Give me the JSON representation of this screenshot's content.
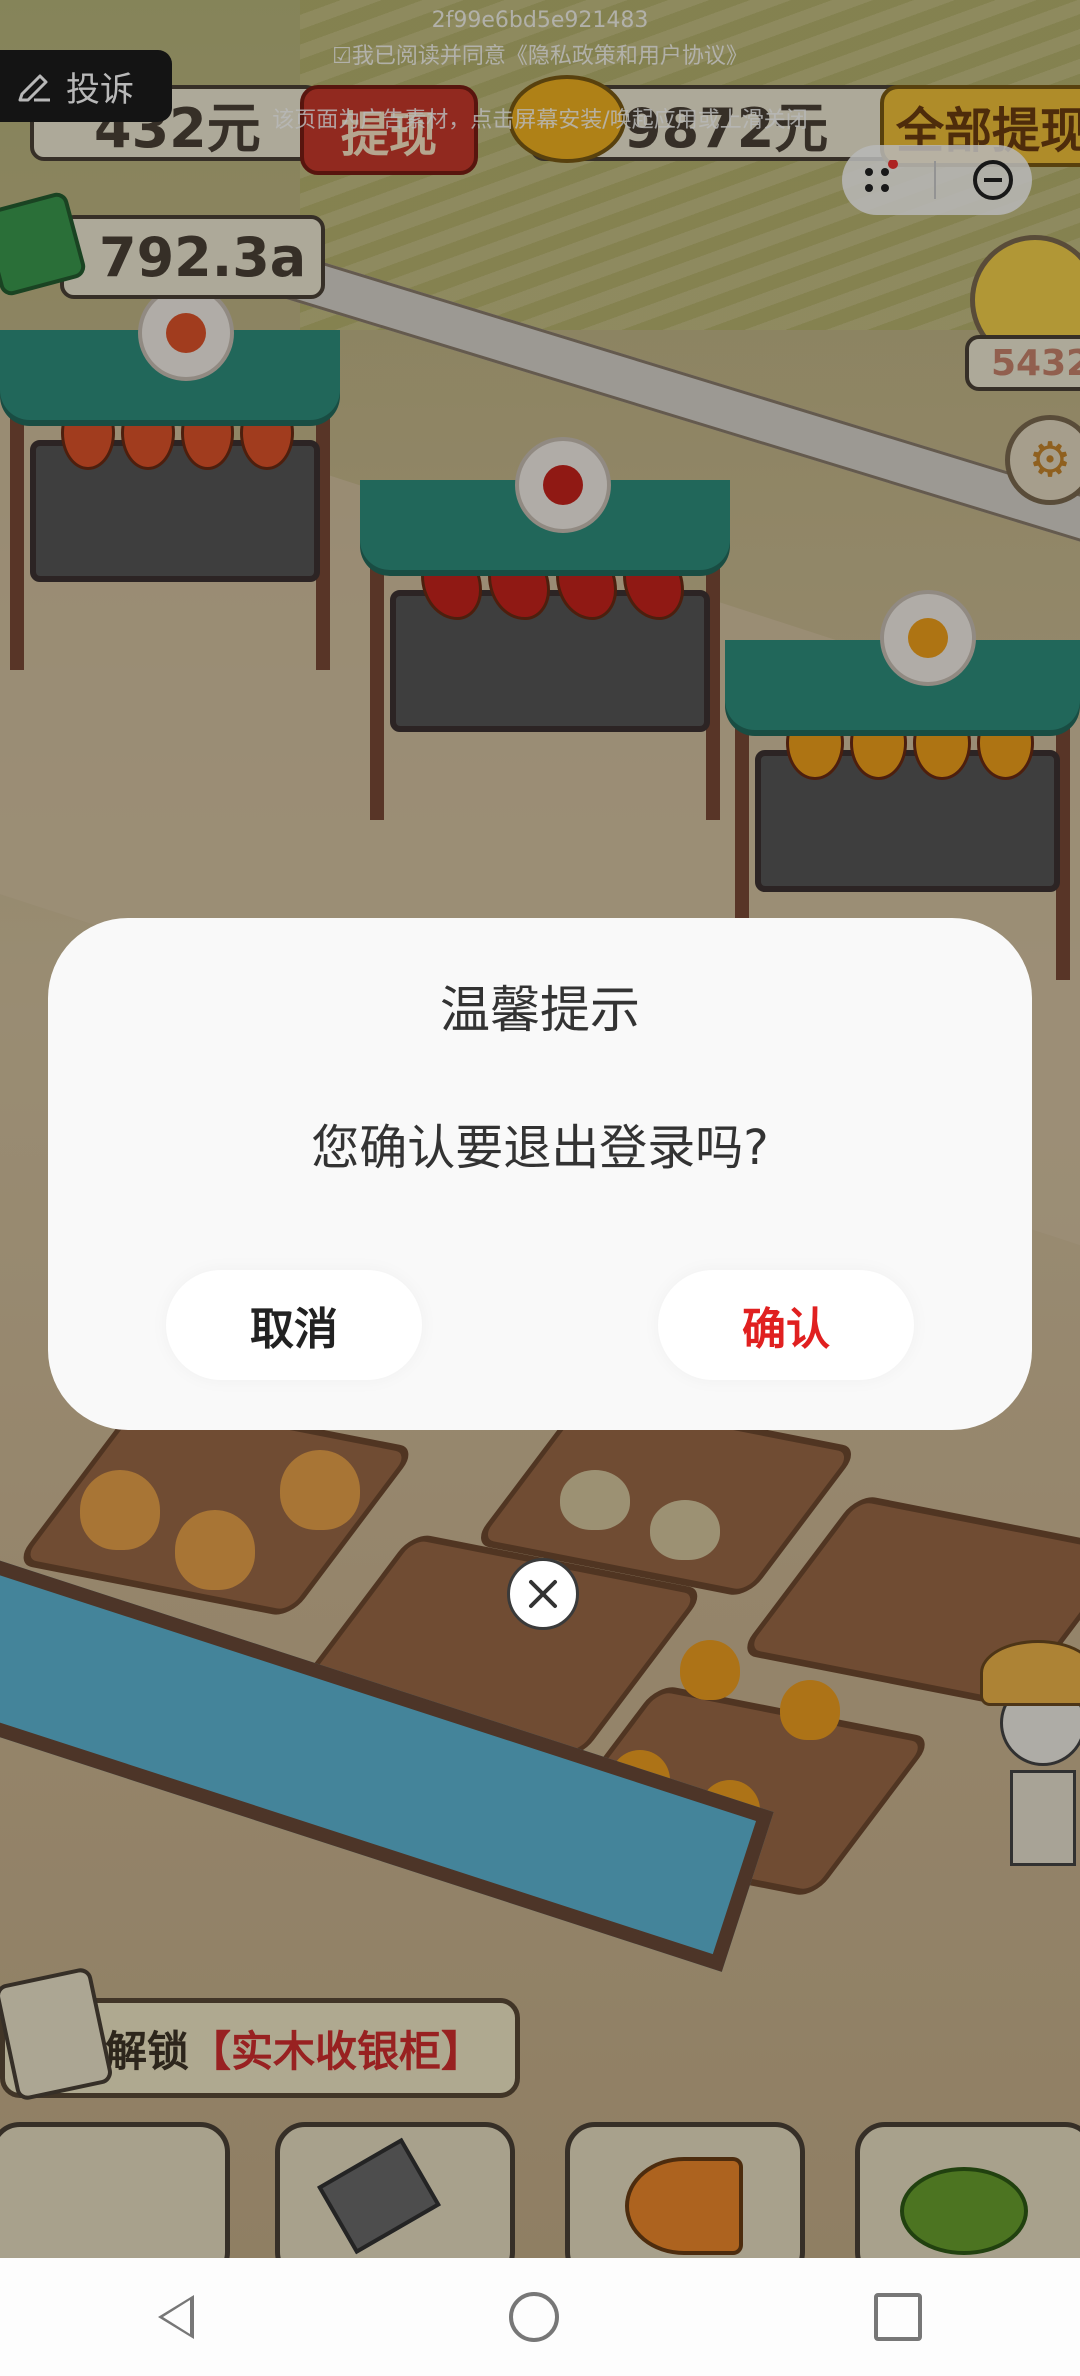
{
  "status": {
    "device_id": "2f99e6bd5e921483",
    "agreement_text": "☑我已阅读并同意《隐私政策和用户协议》",
    "ad_hint": "该页面为广告素材，点击屏幕安装/唤起应用或上滑关闭"
  },
  "complain": {
    "label": "投诉",
    "icon": "complain-pen-icon"
  },
  "hud": {
    "cash_amount": "432元",
    "withdraw_label": "提现",
    "gold_amount": "9872元",
    "withdraw_all_label": "全部提现",
    "income_rate": "792.3a",
    "avatar_score": "5432"
  },
  "mini_program_capsule": {
    "more_icon": "more-dots-icon",
    "close_icon": "minus-circle-icon"
  },
  "dialog": {
    "title": "温馨提示",
    "message": "您确认要退出登录吗?",
    "cancel_label": "取消",
    "confirm_label": "确认",
    "confirm_color": "#e02020"
  },
  "close_button": {
    "icon": "close-x-icon"
  },
  "unlock_banner": {
    "prefix": "解锁",
    "item": "【实木收银柜】"
  },
  "navbar": {
    "back": "back-icon",
    "home": "home-icon",
    "recent": "recent-apps-icon"
  }
}
